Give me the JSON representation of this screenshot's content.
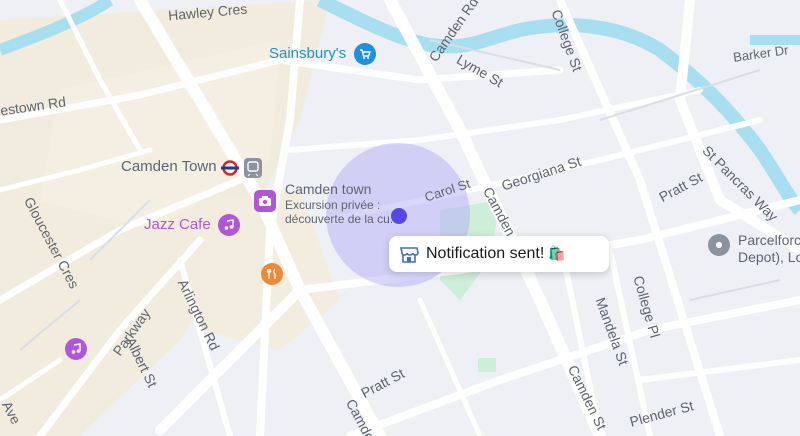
{
  "map": {
    "streets": {
      "hawley_cres": "Hawley Cres",
      "camden_rd_top": "Camden Rd",
      "college_st_top": "College St",
      "barker_dr": "Barker Dr",
      "lyme_st": "Lyme St",
      "estown_rd": "estown Rd",
      "carol_st": "Carol St",
      "georgiana_st": "Georgiana St",
      "camden_st_mid": "Camden St",
      "st_pancras_way": "St Pancras Way",
      "pratt_st_right": "Pratt St",
      "gloucester_cres": "Gloucester Cres",
      "arlington_rd": "Arlington Rd",
      "parkway": "Parkway",
      "albert_st": "Albert St",
      "mandela_st": "Mandela St",
      "college_pl": "College Pl",
      "pratt_st_bottom": "Pratt St",
      "camden_st_bottom": "Camden St",
      "plender_st": "Plender St",
      "camden_bottom_left": "Camden",
      "ave": "Ave"
    },
    "pois": {
      "sainsburys": "Sainsbury's",
      "camden_town_station": "Camden Town",
      "camden_town_attraction_title": "Camden town",
      "camden_town_attraction_line1": "Excursion privée :",
      "camden_town_attraction_line2": "découverte de la cu...",
      "jazz_cafe": "Jazz Cafe",
      "parcelforce_line1": "Parcelforc",
      "parcelforce_line2": "Depot), Lo"
    },
    "notification": {
      "text": "Notification sent!",
      "emoji": "🛍️"
    },
    "colors": {
      "water": "#a8dff0",
      "accent": "#5648e8",
      "geofence": "#b9b4f5",
      "park": "#cdeed9",
      "poi_blue": "#1f8fe0",
      "poi_purple": "#b057d8",
      "poi_orange": "#f0883a",
      "poi_gray": "#8a939e"
    },
    "icons": {
      "shopping_cart": "cart-icon",
      "station": "underground-icon",
      "camera": "camera-icon",
      "music": "music-icon",
      "food": "fork-knife-icon",
      "parcel": "location-pin-icon",
      "store": "store-icon"
    }
  }
}
